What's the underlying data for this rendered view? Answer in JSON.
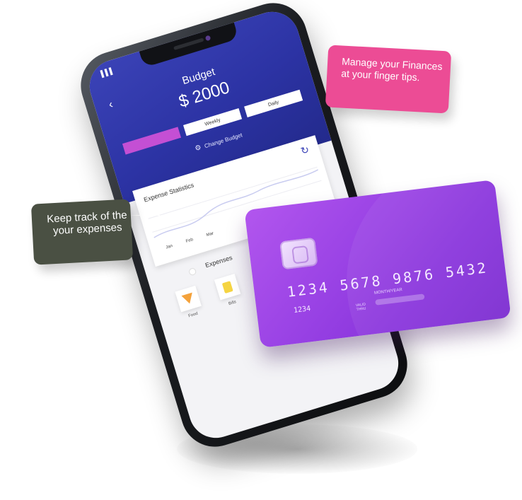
{
  "phone": {
    "signal": "▌▌▌",
    "back_icon": "‹",
    "header": {
      "title": "Budget",
      "amount": "$ 2000",
      "tabs": [
        {
          "label": "",
          "active": true
        },
        {
          "label": "Weekly",
          "active": false
        },
        {
          "label": "Daily",
          "active": false
        }
      ],
      "change_budget_label": "Change Budget",
      "gear_icon": "⚙"
    },
    "stats_card": {
      "title": "Expense Statistics",
      "refresh_icon": "↻",
      "months": [
        "Jan",
        "Feb",
        "Mar"
      ]
    },
    "expenses_section": {
      "title": "Expenses",
      "categories": [
        {
          "label": "Food",
          "icon": "pizza-icon"
        },
        {
          "label": "Bills",
          "icon": "bill-icon"
        }
      ]
    }
  },
  "credit_card": {
    "number": "1234  5678  9876  5432",
    "small_number": "1234",
    "month_year_label": "MONTH/YEAR",
    "valid_thru_label": "VALID THRU"
  },
  "callouts": {
    "finances": "Manage your Finances at your finger tips.",
    "expenses": "Keep track of the your expenses"
  },
  "colors": {
    "phone_header": "#2c33a4",
    "card_purple": "#9a43e5",
    "callout_pink": "#ec4c95",
    "callout_green": "#4a5043"
  }
}
